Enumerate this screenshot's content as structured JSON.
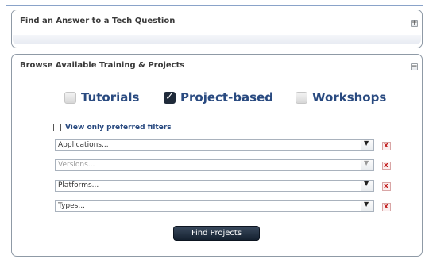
{
  "answer_panel": {
    "title": "Find an Answer to a Tech Question",
    "toggle_glyph": "+",
    "toggle_icon": "expand-icon"
  },
  "browse_panel": {
    "title": "Browse Available Training & Projects",
    "toggle_glyph": "−",
    "toggle_icon": "collapse-icon",
    "tabs": [
      {
        "label": "Tutorials",
        "checked": false
      },
      {
        "label": "Project-based",
        "checked": true
      },
      {
        "label": "Workshops",
        "checked": false
      }
    ],
    "preferred_filters": {
      "label": "View only preferred filters",
      "checked": false
    },
    "filters": [
      {
        "value": "Applications...",
        "enabled": true
      },
      {
        "value": "Versions...",
        "enabled": false
      },
      {
        "value": "Platforms...",
        "enabled": true
      },
      {
        "value": "Types...",
        "enabled": true
      }
    ],
    "dropdown_glyph": "▼",
    "clear_glyph": "x",
    "find_button_label": "Find Projects"
  },
  "colors": {
    "accent": "#294a80",
    "button": "#1a2636",
    "clear": "#c21b1b"
  }
}
